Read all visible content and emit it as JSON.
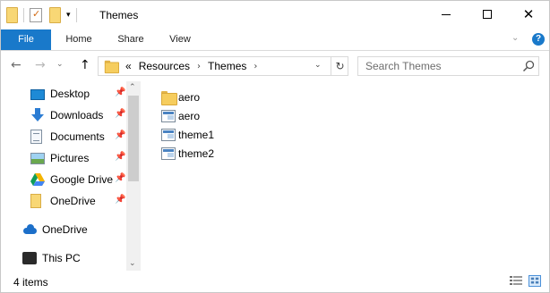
{
  "titlebar": {
    "title": "Themes",
    "qat_dropdown": "▾"
  },
  "window_controls": {
    "close_glyph": "✕"
  },
  "ribbon": {
    "tabs": [
      {
        "label": "File",
        "active": true
      },
      {
        "label": "Home"
      },
      {
        "label": "Share"
      },
      {
        "label": "View"
      }
    ],
    "expand_glyph": "⌄",
    "help_glyph": "?",
    "file_tab_color": "#1979ca"
  },
  "navigation": {
    "back_glyph": "←",
    "forward_glyph": "→",
    "recent_glyph": "⌄",
    "up_glyph": "↑",
    "address": {
      "overflow_glyph": "«",
      "breadcrumbs": [
        "Resources",
        "Themes"
      ],
      "separator_glyph": "›",
      "dropdown_glyph": "⌄",
      "refresh_glyph": "↻"
    },
    "search": {
      "placeholder": "Search Themes",
      "value": ""
    }
  },
  "sidebar": {
    "quick_access": [
      {
        "label": "Desktop",
        "icon": "desktop-icon",
        "pinned": true
      },
      {
        "label": "Downloads",
        "icon": "downloads-icon",
        "pinned": true
      },
      {
        "label": "Documents",
        "icon": "documents-icon",
        "pinned": true
      },
      {
        "label": "Pictures",
        "icon": "pictures-icon",
        "pinned": true
      },
      {
        "label": "Google Drive",
        "icon": "google-drive-icon",
        "pinned": true
      },
      {
        "label": "OneDrive",
        "icon": "folder-icon",
        "pinned": true
      }
    ],
    "onedrive": {
      "label": "OneDrive",
      "icon": "onedrive-cloud-icon"
    },
    "this_pc": {
      "label": "This PC",
      "icon": "computer-icon"
    },
    "pin_glyph": "📌",
    "scroll_up_glyph": "⌃",
    "scroll_down_glyph": "⌄"
  },
  "files": [
    {
      "name": "aero",
      "type": "folder",
      "icon": "folder-icon"
    },
    {
      "name": "aero",
      "type": "theme",
      "icon": "theme-file-icon"
    },
    {
      "name": "theme1",
      "type": "theme",
      "icon": "theme-file-icon"
    },
    {
      "name": "theme2",
      "type": "theme",
      "icon": "theme-file-icon"
    }
  ],
  "status": {
    "item_count": "4 items"
  }
}
